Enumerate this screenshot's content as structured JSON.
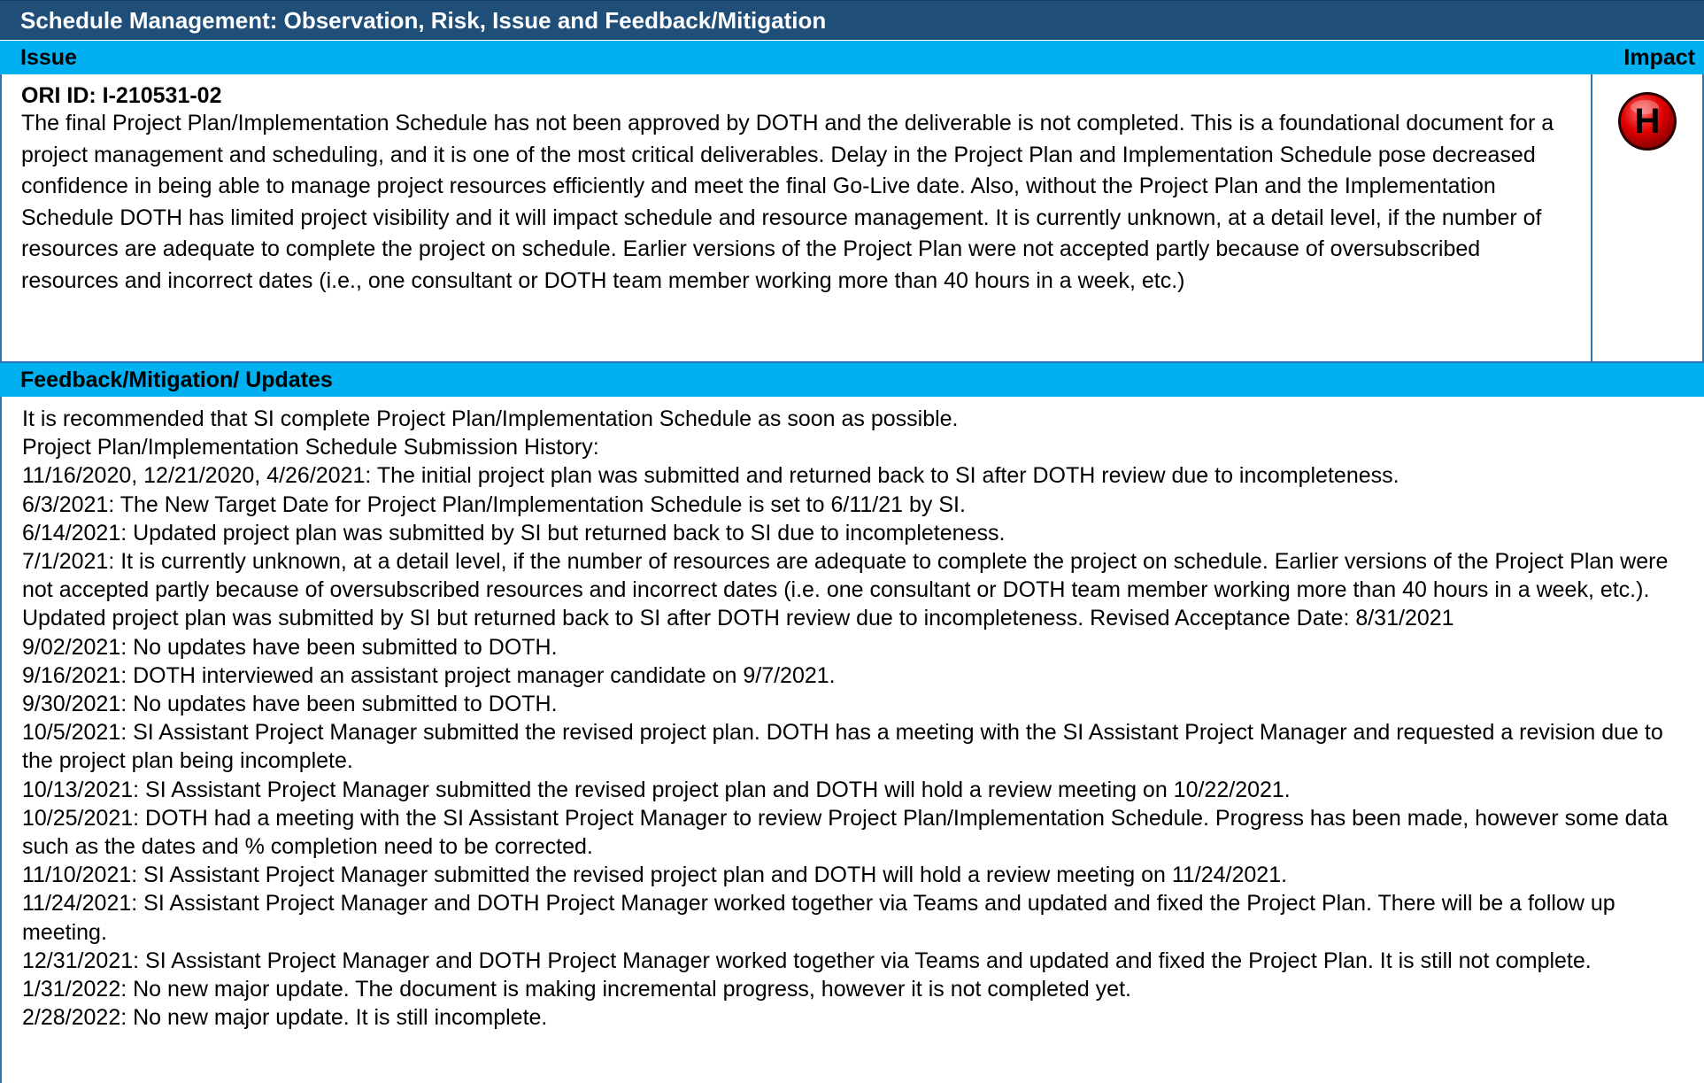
{
  "title": "Schedule Management: Observation, Risk, Issue and Feedback/Mitigation",
  "issue_header": {
    "label": "Issue",
    "impact_label": "Impact"
  },
  "issue": {
    "ori_id": "ORI ID: I-210531-02",
    "description": "The final Project Plan/Implementation Schedule has not been approved by DOTH and the deliverable is not completed. This is a foundational document for a project management and scheduling, and it is one of the most critical deliverables. Delay in the Project Plan and Implementation Schedule pose decreased confidence in being able to manage project resources efficiently and meet the final Go-Live date. Also, without the Project Plan and the Implementation Schedule DOTH has limited project visibility and it will impact schedule and resource management. It is currently unknown, at a detail level, if the number of resources are adequate to complete the project on schedule. Earlier versions of the Project Plan were not accepted partly because of oversubscribed resources and incorrect dates (i.e., one consultant or DOTH team member working more than 40 hours in a week, etc.)",
    "impact": {
      "letter": "H",
      "color": "#e00000"
    }
  },
  "feedback_header": {
    "label": "Feedback/Mitigation/ Updates"
  },
  "feedback": {
    "lines": [
      "It is recommended that SI complete Project Plan/Implementation Schedule as soon as possible.",
      "Project Plan/Implementation Schedule Submission History:",
      "11/16/2020, 12/21/2020, 4/26/2021: The initial project plan was submitted and returned back to SI after DOTH review due to incompleteness.",
      "6/3/2021: The New Target Date for Project Plan/Implementation Schedule is set to 6/11/21 by SI.",
      "6/14/2021: Updated project plan was submitted by SI but returned back to SI due to incompleteness.",
      "7/1/2021: It is currently unknown, at a detail level, if the number of resources are adequate to complete the project on schedule. Earlier versions of the Project Plan were not accepted partly because of oversubscribed resources and incorrect dates (i.e. one consultant or DOTH team member working more than 40 hours in a week, etc.). Updated project plan was submitted by SI but returned back to SI after DOTH review due to incompleteness. Revised Acceptance Date: 8/31/2021",
      "9/02/2021: No updates have been submitted to DOTH.",
      "9/16/2021: DOTH interviewed an assistant project manager candidate on 9/7/2021.",
      "9/30/2021: No updates have been submitted to DOTH.",
      "10/5/2021: SI Assistant Project Manager submitted the revised project plan. DOTH has a meeting with the SI Assistant Project Manager and requested a revision due to the project plan being incomplete.",
      "10/13/2021: SI Assistant Project Manager submitted the revised project plan and DOTH will hold a review meeting on 10/22/2021.",
      "10/25/2021: DOTH had a meeting with the SI Assistant Project Manager to review Project Plan/Implementation Schedule. Progress has been made, however some data such as the dates and % completion need to be corrected.",
      "11/10/2021: SI Assistant Project Manager submitted the revised project plan and DOTH will hold a review meeting on 11/24/2021.",
      "11/24/2021: SI Assistant Project Manager and DOTH Project Manager worked together via Teams and updated and fixed the Project Plan. There will be a follow up meeting.",
      "12/31/2021: SI Assistant Project Manager and DOTH Project Manager worked together via Teams and updated and fixed the Project Plan. It is still not complete.",
      "1/31/2022: No new major update.  The document is making incremental progress, however it is not completed yet.",
      "2/28/2022: No new major update. It is still incomplete."
    ]
  },
  "colors": {
    "title_bar": "#1f4e79",
    "section_header": "#00b0f0",
    "border": "#2e75b6"
  }
}
